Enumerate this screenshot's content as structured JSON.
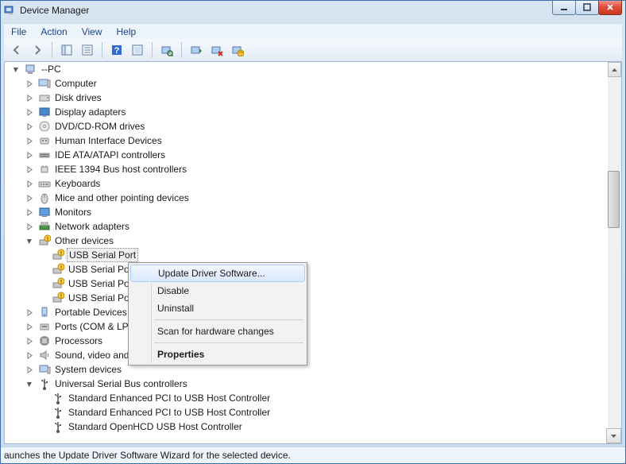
{
  "window": {
    "title": "Device Manager"
  },
  "menu": {
    "file": "File",
    "action": "Action",
    "view": "View",
    "help": "Help"
  },
  "toolbar_icons": [
    "back",
    "forward",
    "show-hide-tree",
    "properties",
    "help",
    "scan",
    "monitor",
    "update-driver",
    "disable",
    "uninstall"
  ],
  "tree": {
    "root": "--PC",
    "items": [
      {
        "label": "Computer",
        "icon": "computer"
      },
      {
        "label": "Disk drives",
        "icon": "disk"
      },
      {
        "label": "Display adapters",
        "icon": "display"
      },
      {
        "label": "DVD/CD-ROM drives",
        "icon": "dvd"
      },
      {
        "label": "Human Interface Devices",
        "icon": "hid"
      },
      {
        "label": "IDE ATA/ATAPI controllers",
        "icon": "ide"
      },
      {
        "label": "IEEE 1394 Bus host controllers",
        "icon": "ieee"
      },
      {
        "label": "Keyboards",
        "icon": "keyboard"
      },
      {
        "label": "Mice and other pointing devices",
        "icon": "mouse"
      },
      {
        "label": "Monitors",
        "icon": "monitor"
      },
      {
        "label": "Network adapters",
        "icon": "network"
      }
    ],
    "other_devices": {
      "label": "Other devices",
      "children": [
        "USB Serial Port",
        "USB Serial Po",
        "USB Serial Po",
        "USB Serial Po"
      ]
    },
    "after": [
      {
        "label": "Portable Devices",
        "icon": "portable"
      },
      {
        "label": "Ports (COM & LP",
        "icon": "ports"
      },
      {
        "label": "Processors",
        "icon": "cpu"
      },
      {
        "label": "Sound, video and",
        "icon": "sound"
      },
      {
        "label": "System devices",
        "icon": "system"
      }
    ],
    "usb": {
      "label": "Universal Serial Bus controllers",
      "children": [
        "Standard Enhanced PCI to USB Host Controller",
        "Standard Enhanced PCI to USB Host Controller",
        "Standard OpenHCD USB Host Controller"
      ]
    }
  },
  "context_menu": {
    "update": "Update Driver Software...",
    "disable": "Disable",
    "uninstall": "Uninstall",
    "scan": "Scan for hardware changes",
    "properties": "Properties"
  },
  "status": "aunches the Update Driver Software Wizard for the selected device."
}
